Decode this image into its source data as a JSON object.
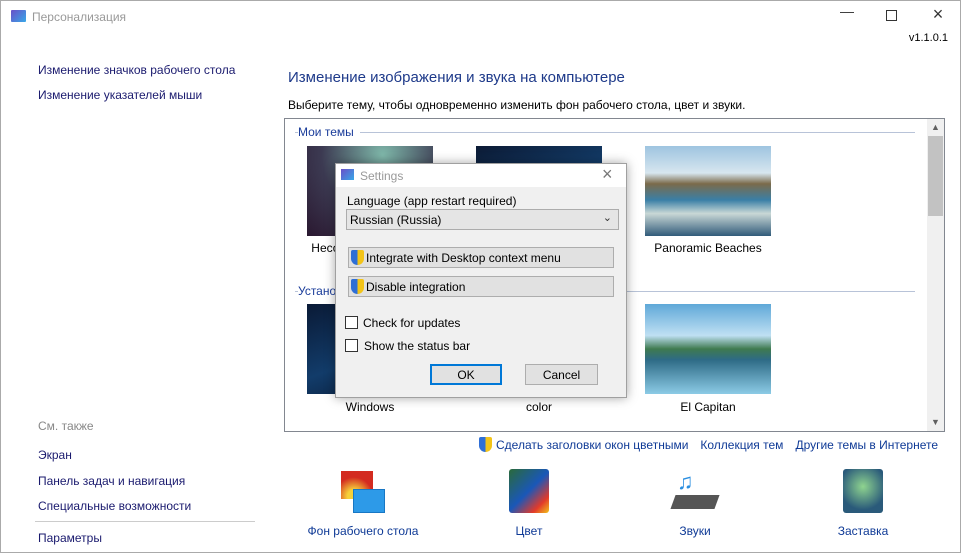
{
  "window": {
    "title": "Персонализация",
    "version": "v1.1.0.1"
  },
  "sidebar": {
    "links": [
      "Изменение значков рабочего стола",
      "Изменение указателей мыши"
    ],
    "see_also_label": "См. также",
    "see_also": [
      "Экран",
      "Панель задач и навигация",
      "Специальные возможности"
    ],
    "settings_link": "Параметры"
  },
  "main": {
    "heading": "Изменение изображения и звука на компьютере",
    "subtitle": "Выберите тему, чтобы одновременно изменить фон рабочего стола, цвет и звуки.",
    "groups": [
      {
        "label": "Мои темы",
        "themes": [
          "Несохраненная тема",
          "",
          "Panoramic Beaches"
        ]
      },
      {
        "label": "Установленные темы",
        "themes": [
          "Windows",
          "color",
          "El Capitan"
        ]
      }
    ],
    "bottom_links": [
      "Сделать заголовки окон цветными",
      "Коллекция тем",
      "Другие темы в Интернете"
    ],
    "bottom_items": [
      "Фон рабочего стола",
      "Цвет",
      "Звуки",
      "Заставка"
    ]
  },
  "dialog": {
    "title": "Settings",
    "language_label": "Language (app restart required)",
    "language_value": "Russian (Russia)",
    "integrate_button": "Integrate with Desktop context menu",
    "disable_button": "Disable integration",
    "check_updates": {
      "label": "Check for updates",
      "checked": false
    },
    "status_bar": {
      "label": "Show the status bar",
      "checked": false
    },
    "ok": "OK",
    "cancel": "Cancel"
  },
  "colors": {
    "link": "#1a1a6e",
    "heading": "#1e3a8a",
    "accent": "#0078d7"
  }
}
